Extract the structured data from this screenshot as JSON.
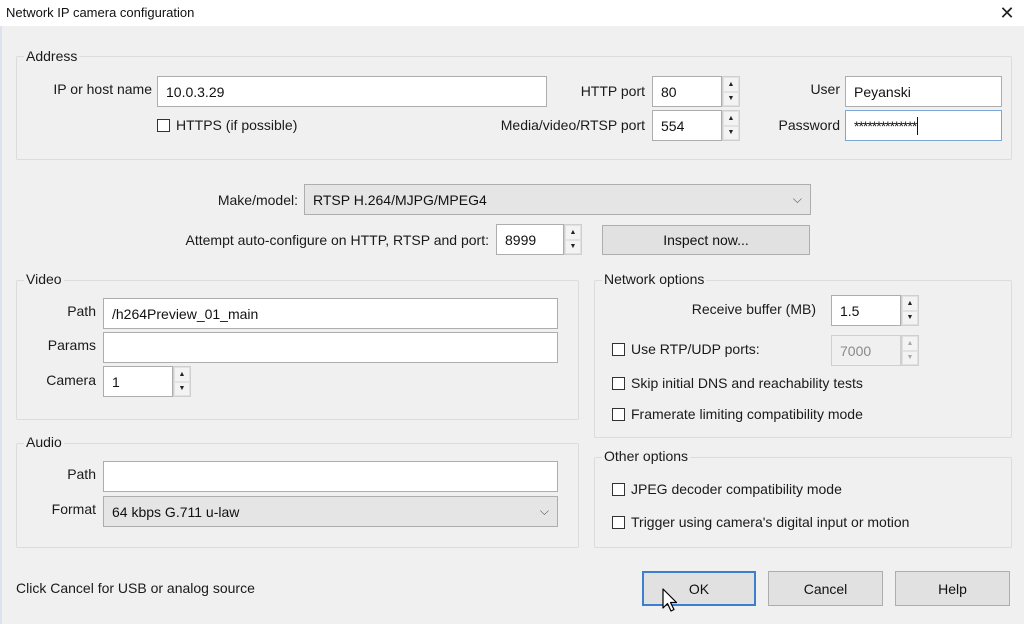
{
  "window": {
    "title": "Network IP camera configuration",
    "close_icon": "close-icon"
  },
  "address": {
    "legend": "Address",
    "ip_label": "IP or host name",
    "ip_value": "10.0.3.29",
    "https_label": "HTTPS (if possible)",
    "https_checked": false,
    "http_port_label": "HTTP port",
    "http_port_value": "80",
    "media_port_label": "Media/video/RTSP port",
    "media_port_value": "554",
    "user_label": "User",
    "user_value": "Peyanski",
    "password_label": "Password",
    "password_value": "**************"
  },
  "make_model": {
    "label": "Make/model:",
    "value": "RTSP H.264/MJPG/MPEG4"
  },
  "auto_configure": {
    "label": "Attempt auto-configure on HTTP, RTSP and port:",
    "port_value": "8999",
    "inspect_label": "Inspect now..."
  },
  "video": {
    "legend": "Video",
    "path_label": "Path",
    "path_value": "/h264Preview_01_main",
    "params_label": "Params",
    "params_value": "",
    "camera_label": "Camera",
    "camera_value": "1"
  },
  "audio": {
    "legend": "Audio",
    "path_label": "Path",
    "path_value": "",
    "format_label": "Format",
    "format_value": "64 kbps G.711 u-law"
  },
  "network_options": {
    "legend": "Network options",
    "receive_buffer_label": "Receive buffer (MB)",
    "receive_buffer_value": "1.5",
    "rtp_udp_label": "Use RTP/UDP ports:",
    "rtp_udp_checked": false,
    "rtp_udp_value": "7000",
    "skip_dns_label": "Skip initial DNS and reachability tests",
    "skip_dns_checked": false,
    "framerate_label": "Framerate limiting compatibility mode",
    "framerate_checked": false
  },
  "other_options": {
    "legend": "Other options",
    "jpeg_label": "JPEG decoder compatibility mode",
    "jpeg_checked": false,
    "trigger_label": "Trigger using camera's digital input or motion",
    "trigger_checked": false
  },
  "footer": {
    "hint": "Click Cancel for USB or analog source",
    "ok_label": "OK",
    "cancel_label": "Cancel",
    "help_label": "Help"
  },
  "colors": {
    "dialog_bg": "#f0f0f0",
    "focus_border": "#3c7fd0"
  }
}
